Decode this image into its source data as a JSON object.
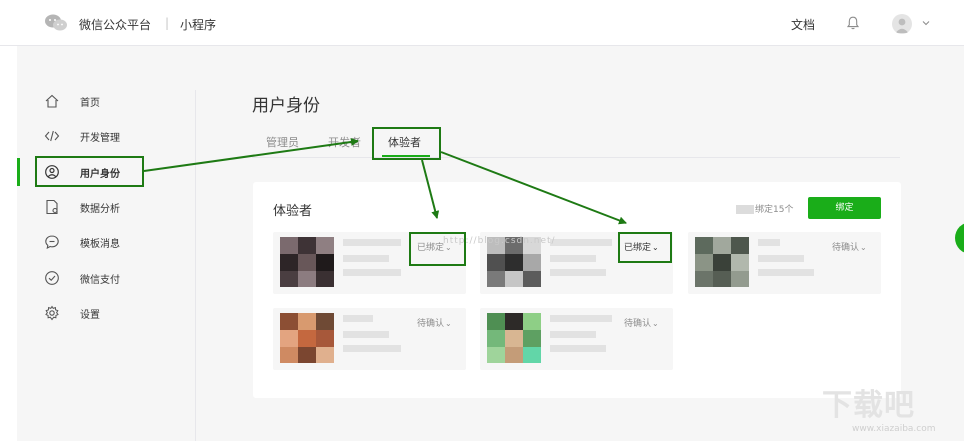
{
  "header": {
    "brand": "微信公众平台",
    "separator": "|",
    "product": "小程序",
    "docs": "文档"
  },
  "sidebar": {
    "items": [
      {
        "label": "首页",
        "icon": "home-icon"
      },
      {
        "label": "开发管理",
        "icon": "code-icon"
      },
      {
        "label": "用户身份",
        "icon": "user-circle-icon"
      },
      {
        "label": "数据分析",
        "icon": "file-chart-icon"
      },
      {
        "label": "模板消息",
        "icon": "chat-icon"
      },
      {
        "label": "微信支付",
        "icon": "check-circle-icon"
      },
      {
        "label": "设置",
        "icon": "gear-icon"
      }
    ],
    "active_index": 2
  },
  "main": {
    "title": "用户身份",
    "tabs": [
      {
        "label": "管理员"
      },
      {
        "label": "开发者"
      },
      {
        "label": "体验者"
      }
    ],
    "active_tab": 2,
    "card": {
      "title": "体验者",
      "bind_count": "绑定15个",
      "bind_button": "绑定",
      "testers": [
        {
          "status": "已绑定"
        },
        {
          "status": "已绑定"
        },
        {
          "status": "待确认"
        },
        {
          "status": "待确认"
        },
        {
          "status": "待确认"
        }
      ]
    }
  },
  "watermarks": {
    "blog_url": "http://blog.csdn.net/",
    "site_logo": "下载吧",
    "site_url": "www.xiazaiba.com"
  },
  "colors": {
    "accent": "#1aad19",
    "annotation": "#1e7a14",
    "sidebar_bg": "#f6f6f6"
  }
}
